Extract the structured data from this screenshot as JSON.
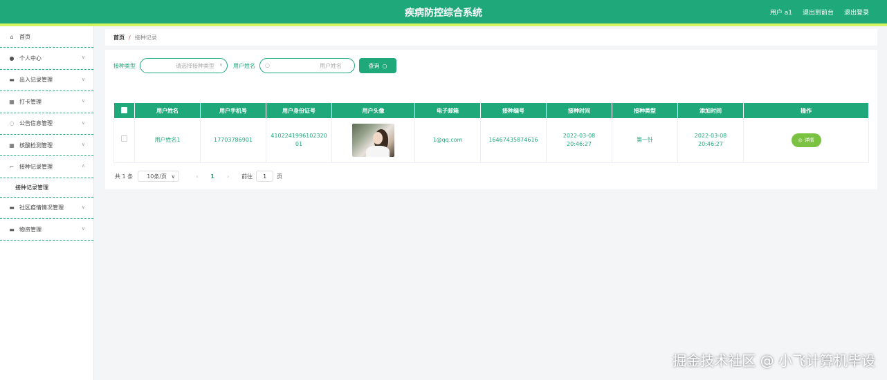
{
  "header": {
    "title": "疾病防控综合系统",
    "user_label": "用户 a1",
    "back_to_front": "退出到前台",
    "logout": "退出登录"
  },
  "sidebar": {
    "items": [
      {
        "label": "首页",
        "icon": "home-icon",
        "has_children": false
      },
      {
        "label": "个人中心",
        "icon": "user-icon",
        "has_children": true
      },
      {
        "label": "出入记录管理",
        "icon": "briefcase-icon",
        "has_children": true
      },
      {
        "label": "打卡管理",
        "icon": "calendar-icon",
        "has_children": true
      },
      {
        "label": "公告信息管理",
        "icon": "loading-icon",
        "has_children": true
      },
      {
        "label": "核酸检测管理",
        "icon": "grid-icon",
        "has_children": true
      },
      {
        "label": "接种记录管理",
        "icon": "crop-icon",
        "has_children": true,
        "expanded": true
      },
      {
        "label": "社区疫情情况管理",
        "icon": "monitor-icon",
        "has_children": true
      },
      {
        "label": "物资管理",
        "icon": "monitor-icon",
        "has_children": true
      }
    ],
    "active_submenu": "接种记录管理"
  },
  "breadcrumb": {
    "home": "首页",
    "separator": "/",
    "current": "接种记录"
  },
  "search": {
    "type_label": "接种类型",
    "type_placeholder": "请选择接种类型",
    "name_label": "用户姓名",
    "name_placeholder": "用户姓名",
    "query_button": "查询"
  },
  "table": {
    "columns": [
      "用户姓名",
      "用户手机号",
      "用户身份证号",
      "用户头像",
      "电子邮箱",
      "接种编号",
      "接种时间",
      "接种类型",
      "添加时间",
      "操作"
    ],
    "rows": [
      {
        "name": "用户姓名1",
        "phone": "17703786901",
        "id_card": "410224199610232001",
        "email": "1@qq.com",
        "vaccine_no": "16467435874616",
        "vaccine_time": "2022-03-08 20:46:27",
        "vaccine_type": "第一针",
        "added_time": "2022-03-08 20:46:27",
        "action": "详情"
      }
    ]
  },
  "pager": {
    "total": "共 1 条",
    "page_size": "10条/页",
    "current_page": "1",
    "goto_label": "前往",
    "goto_value": "1",
    "page_unit": "页"
  },
  "watermark": "掘金技术社区 @ 小飞计算机毕设",
  "colors": {
    "primary": "#1fa87a",
    "accent_stripe": "#d5f45b",
    "detail_button": "#7cc242"
  }
}
